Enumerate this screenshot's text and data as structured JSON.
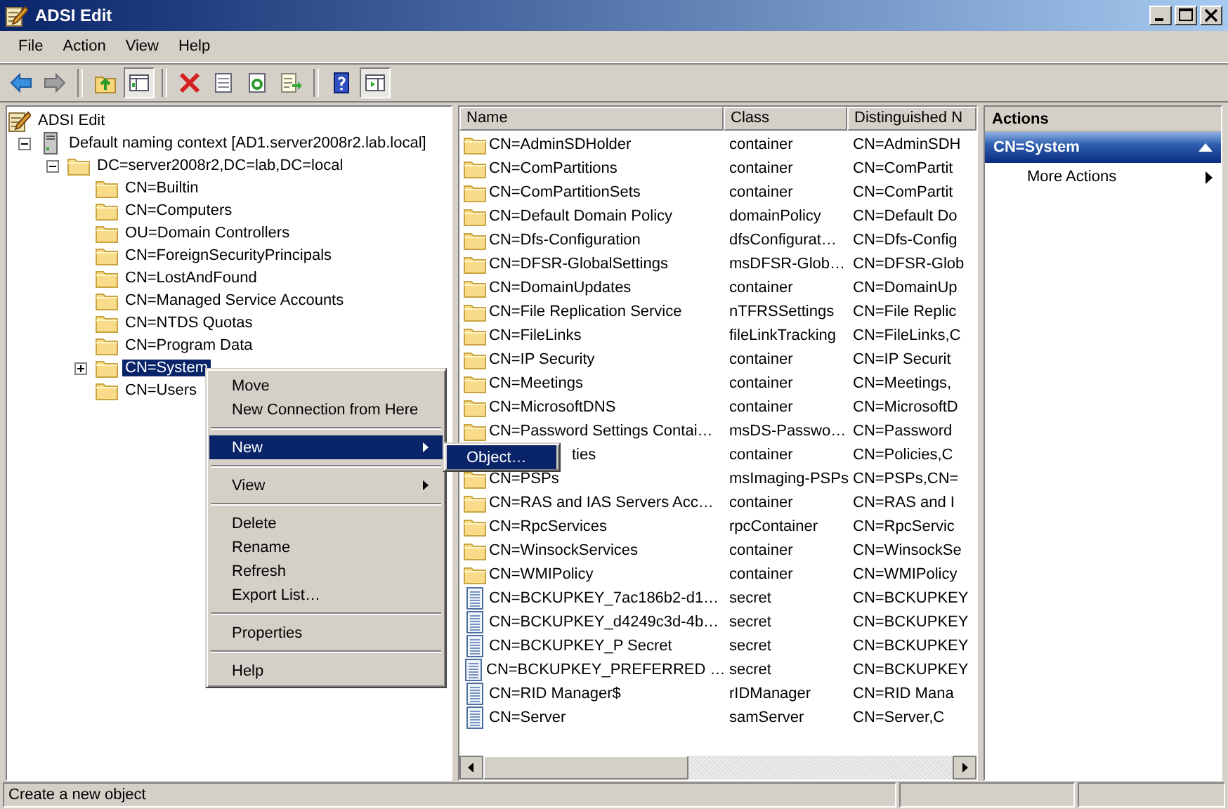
{
  "window": {
    "title": "ADSI Edit"
  },
  "menu_bar": [
    "File",
    "Action",
    "View",
    "Help"
  ],
  "toolbar": [
    {
      "kind": "back",
      "on": false
    },
    {
      "kind": "forward",
      "on": false
    },
    {
      "kind": "separator"
    },
    {
      "kind": "up",
      "on": false
    },
    {
      "kind": "tree",
      "on": true
    },
    {
      "kind": "separator"
    },
    {
      "kind": "delete",
      "on": false
    },
    {
      "kind": "properties",
      "on": false
    },
    {
      "kind": "refresh",
      "on": false
    },
    {
      "kind": "export",
      "on": false
    },
    {
      "kind": "separator"
    },
    {
      "kind": "help",
      "on": false
    },
    {
      "kind": "actionpane",
      "on": true
    }
  ],
  "tree": {
    "label": "ADSI Edit",
    "kind": "adsi",
    "selected": false,
    "children": [
      {
        "label": "Default naming context [AD1.server2008r2.lab.local]",
        "kind": "server",
        "selected": false,
        "expanded": true,
        "children": [
          {
            "label": "DC=server2008r2,DC=lab,DC=local",
            "kind": "folder",
            "selected": false,
            "expanded": true,
            "children": [
              {
                "label": "CN=Builtin",
                "kind": "folder",
                "selected": false
              },
              {
                "label": "CN=Computers",
                "kind": "folder",
                "selected": false
              },
              {
                "label": "OU=Domain Controllers",
                "kind": "folder",
                "selected": false
              },
              {
                "label": "CN=ForeignSecurityPrincipals",
                "kind": "folder",
                "selected": false
              },
              {
                "label": "CN=LostAndFound",
                "kind": "folder",
                "selected": false
              },
              {
                "label": "CN=Managed Service Accounts",
                "kind": "folder",
                "selected": false
              },
              {
                "label": "CN=NTDS Quotas",
                "kind": "folder",
                "selected": false
              },
              {
                "label": "CN=Program Data",
                "kind": "folder",
                "selected": false
              },
              {
                "label": "CN=System",
                "kind": "folder",
                "selected": true,
                "expanded": false
              },
              {
                "label": "CN=Users",
                "kind": "folder",
                "selected": false
              }
            ]
          }
        ]
      }
    ]
  },
  "list": {
    "columns": [
      "Name",
      "Class",
      "Distinguished N"
    ],
    "rows": [
      {
        "kind": "folder",
        "name": "CN=AdminSDHolder",
        "class": "container",
        "dn": "CN=AdminSDH"
      },
      {
        "kind": "folder",
        "name": "CN=ComPartitions",
        "class": "container",
        "dn": "CN=ComPartit"
      },
      {
        "kind": "folder",
        "name": "CN=ComPartitionSets",
        "class": "container",
        "dn": "CN=ComPartit"
      },
      {
        "kind": "folder",
        "name": "CN=Default Domain Policy",
        "class": "domainPolicy",
        "dn": "CN=Default Do"
      },
      {
        "kind": "folder",
        "name": "CN=Dfs-Configuration",
        "class": "dfsConfigurat…",
        "dn": "CN=Dfs-Config"
      },
      {
        "kind": "folder",
        "name": "CN=DFSR-GlobalSettings",
        "class": "msDFSR-Glob…",
        "dn": "CN=DFSR-Glob"
      },
      {
        "kind": "folder",
        "name": "CN=DomainUpdates",
        "class": "container",
        "dn": "CN=DomainUp"
      },
      {
        "kind": "folder",
        "name": "CN=File Replication Service",
        "class": "nTFRSSettings",
        "dn": "CN=File Replic"
      },
      {
        "kind": "folder",
        "name": "CN=FileLinks",
        "class": "fileLinkTracking",
        "dn": "CN=FileLinks,C"
      },
      {
        "kind": "folder",
        "name": "CN=IP Security",
        "class": "container",
        "dn": "CN=IP Securit"
      },
      {
        "kind": "folder",
        "name": "CN=Meetings",
        "class": "container",
        "dn": "CN=Meetings,"
      },
      {
        "kind": "folder",
        "name": "CN=MicrosoftDNS",
        "class": "container",
        "dn": "CN=MicrosoftD"
      },
      {
        "kind": "folder",
        "name": "CN=Password Settings Contai…",
        "class": "msDS-Passwo…",
        "dn": "CN=Password"
      },
      {
        "name": "ties",
        "class": "container",
        "dn": "CN=Policies,C"
      },
      {
        "kind": "folder",
        "name": "CN=PSPs",
        "class": "msImaging-PSPs",
        "dn": "CN=PSPs,CN="
      },
      {
        "kind": "folder",
        "name": "CN=RAS and IAS Servers Acc…",
        "class": "container",
        "dn": "CN=RAS and I"
      },
      {
        "kind": "folder",
        "name": "CN=RpcServices",
        "class": "rpcContainer",
        "dn": "CN=RpcServic"
      },
      {
        "kind": "folder",
        "name": "CN=WinsockServices",
        "class": "container",
        "dn": "CN=WinsockSe"
      },
      {
        "kind": "folder",
        "name": "CN=WMIPolicy",
        "class": "container",
        "dn": "CN=WMIPolicy"
      },
      {
        "kind": "secret",
        "name": "CN=BCKUPKEY_7ac186b2-d1…",
        "class": "secret",
        "dn": "CN=BCKUPKEY"
      },
      {
        "kind": "secret",
        "name": "CN=BCKUPKEY_d4249c3d-4b…",
        "class": "secret",
        "dn": "CN=BCKUPKEY"
      },
      {
        "kind": "secret",
        "name": "CN=BCKUPKEY_P Secret",
        "class": "secret",
        "dn": "CN=BCKUPKEY"
      },
      {
        "kind": "secret",
        "name": "CN=BCKUPKEY_PREFERRED …",
        "class": "secret",
        "dn": "CN=BCKUPKEY"
      },
      {
        "kind": "secret",
        "name": "CN=RID Manager$",
        "class": "rIDManager",
        "dn": "CN=RID Mana"
      },
      {
        "kind": "secret",
        "name": "CN=Server",
        "class": "samServer",
        "dn": "CN=Server,C"
      }
    ]
  },
  "actions": {
    "title": "Actions",
    "section": "CN=System",
    "expanded": true,
    "items": [
      "More Actions"
    ]
  },
  "context_menu": {
    "items": [
      {
        "kind": "item",
        "label": "Move",
        "selected": false
      },
      {
        "kind": "item",
        "label": "New Connection from Here",
        "selected": false
      },
      {
        "kind": "separator"
      },
      {
        "kind": "submenu",
        "label": "New",
        "selected": true
      },
      {
        "kind": "separator"
      },
      {
        "kind": "submenu",
        "label": "View",
        "selected": false
      },
      {
        "kind": "separator"
      },
      {
        "kind": "item",
        "label": "Delete",
        "selected": false
      },
      {
        "kind": "item",
        "label": "Rename",
        "selected": false
      },
      {
        "kind": "item",
        "label": "Refresh",
        "selected": false
      },
      {
        "kind": "item",
        "label": "Export List…",
        "selected": false
      },
      {
        "kind": "separator"
      },
      {
        "kind": "item",
        "label": "Properties",
        "selected": false
      },
      {
        "kind": "separator"
      },
      {
        "kind": "item",
        "label": "Help",
        "selected": false
      }
    ],
    "submenu": [
      {
        "label": "Object…",
        "selected": true
      }
    ]
  },
  "status_bar": "Create a new object"
}
